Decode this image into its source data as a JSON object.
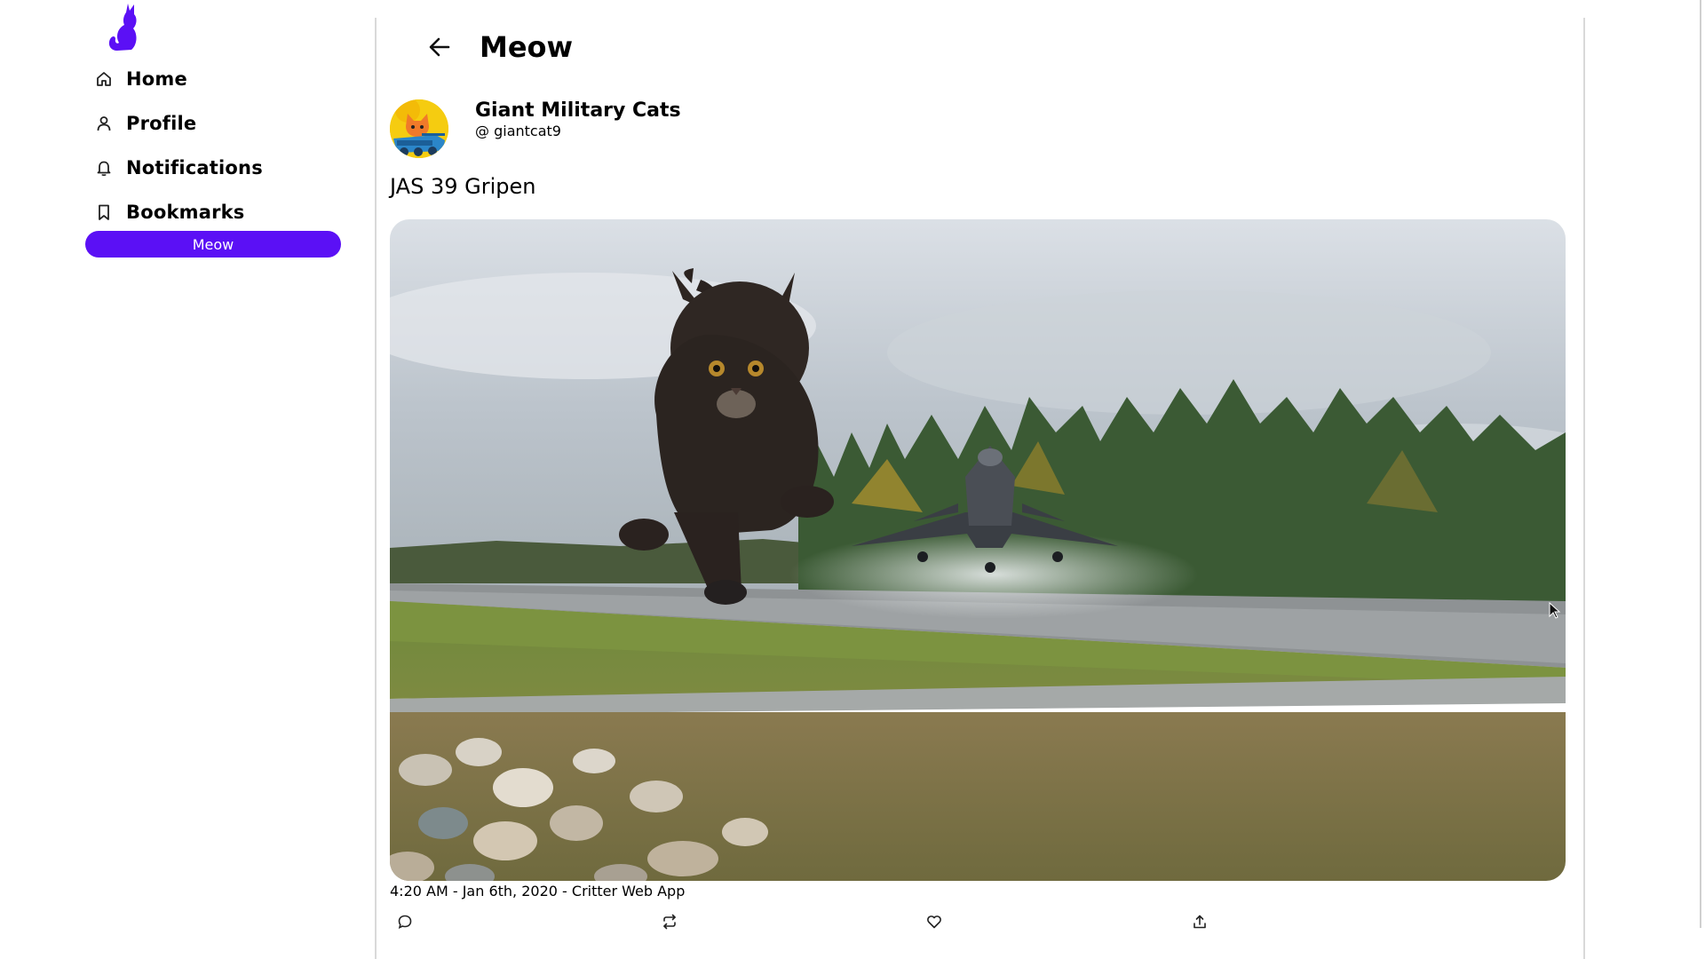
{
  "sidebar": {
    "logo_icon": "cat-logo-icon",
    "brand_color": "#5b10f5",
    "items": [
      {
        "label": "Home",
        "icon": "home-icon"
      },
      {
        "label": "Profile",
        "icon": "user-icon"
      },
      {
        "label": "Notifications",
        "icon": "bell-icon"
      },
      {
        "label": "Bookmarks",
        "icon": "bookmark-icon"
      }
    ],
    "compose_label": "Meow"
  },
  "header": {
    "back_icon": "arrow-left-icon",
    "title": "Meow"
  },
  "post": {
    "author_name": "Giant Military Cats",
    "author_handle": "@ giantcat9",
    "text": "JAS 39 Gripen",
    "meta": "4:20 AM - Jan 6th, 2020 - Critter Web App",
    "actions": [
      {
        "icon": "reply-icon"
      },
      {
        "icon": "retweet-icon"
      },
      {
        "icon": "heart-icon"
      },
      {
        "icon": "share-icon"
      }
    ]
  }
}
